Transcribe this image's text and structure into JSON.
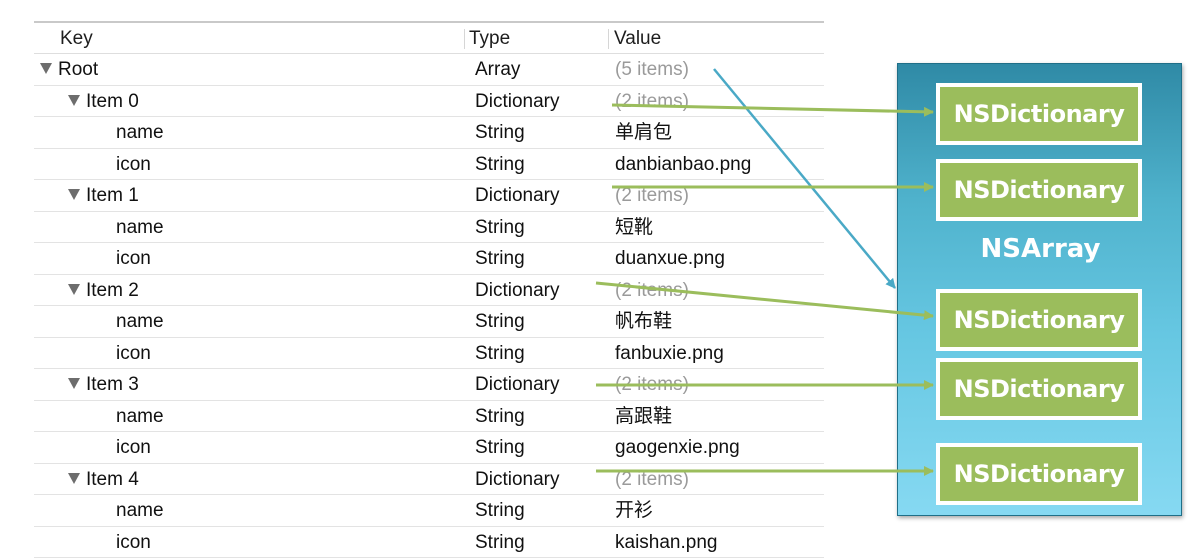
{
  "plist": {
    "headers": {
      "key": "Key",
      "type": "Type",
      "value": "Value"
    },
    "rows": [
      {
        "key": "Root",
        "type": "Array",
        "value": "(5 items)",
        "level": 0,
        "expandable": true
      },
      {
        "key": "Item 0",
        "type": "Dictionary",
        "value": "(2 items)",
        "level": 1,
        "expandable": true
      },
      {
        "key": "name",
        "type": "String",
        "value": "单肩包",
        "level": 2,
        "expandable": false
      },
      {
        "key": "icon",
        "type": "String",
        "value": "danbianbao.png",
        "level": 2,
        "expandable": false
      },
      {
        "key": "Item 1",
        "type": "Dictionary",
        "value": "(2 items)",
        "level": 1,
        "expandable": true
      },
      {
        "key": "name",
        "type": "String",
        "value": "短靴",
        "level": 2,
        "expandable": false
      },
      {
        "key": "icon",
        "type": "String",
        "value": "duanxue.png",
        "level": 2,
        "expandable": false
      },
      {
        "key": "Item 2",
        "type": "Dictionary",
        "value": "(2 items)",
        "level": 1,
        "expandable": true
      },
      {
        "key": "name",
        "type": "String",
        "value": "帆布鞋",
        "level": 2,
        "expandable": false
      },
      {
        "key": "icon",
        "type": "String",
        "value": "fanbuxie.png",
        "level": 2,
        "expandable": false
      },
      {
        "key": "Item 3",
        "type": "Dictionary",
        "value": "(2 items)",
        "level": 1,
        "expandable": true
      },
      {
        "key": "name",
        "type": "String",
        "value": "高跟鞋",
        "level": 2,
        "expandable": false
      },
      {
        "key": "icon",
        "type": "String",
        "value": "gaogenxie.png",
        "level": 2,
        "expandable": false
      },
      {
        "key": "Item 4",
        "type": "Dictionary",
        "value": "(2 items)",
        "level": 1,
        "expandable": true
      },
      {
        "key": "name",
        "type": "String",
        "value": "开衫",
        "level": 2,
        "expandable": false
      },
      {
        "key": "icon",
        "type": "String",
        "value": "kaishan.png",
        "level": 2,
        "expandable": false
      }
    ]
  },
  "diagram": {
    "array_label": "NSArray",
    "dictionaries": [
      "NSDictionary",
      "NSDictionary",
      "NSDictionary",
      "NSDictionary",
      "NSDictionary"
    ],
    "colors": {
      "array_arrow": "#4aa9c6",
      "dict_arrow": "#9bbd5c",
      "dict_box": "#9bbd5c",
      "array_panel": "#4fb2cc"
    }
  }
}
